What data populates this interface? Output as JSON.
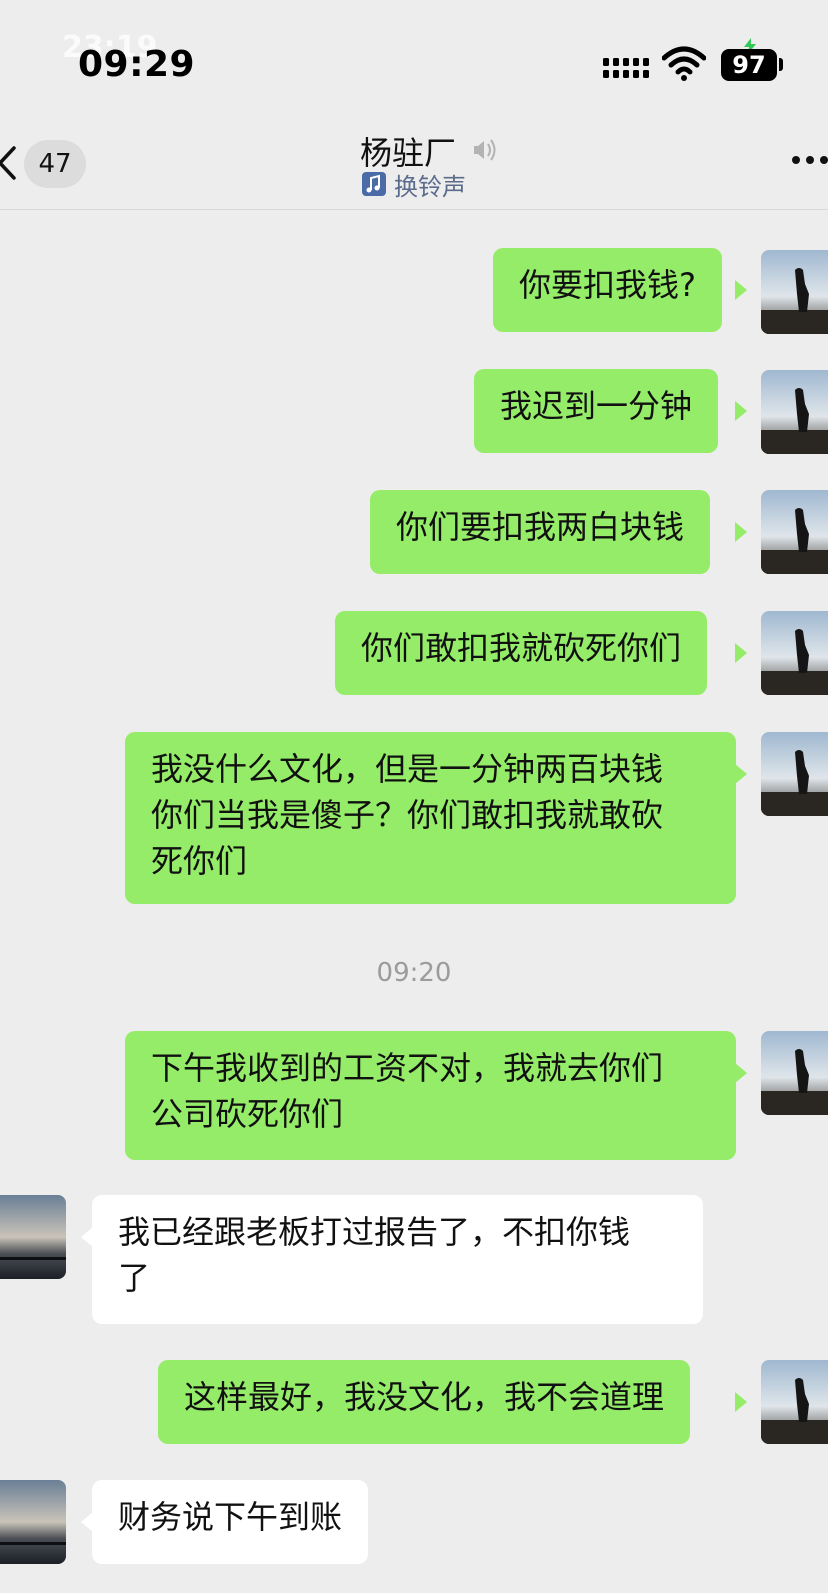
{
  "status_bar": {
    "ghost_time": "23:19",
    "time": "09:29",
    "battery": "97"
  },
  "nav": {
    "unread_count": "47",
    "title": "杨驻厂",
    "subtitle": "换铃声"
  },
  "messages": [
    {
      "side": "out",
      "text": "你要扣我钱?"
    },
    {
      "side": "out",
      "text": "我迟到一分钟"
    },
    {
      "side": "out",
      "text": "你们要扣我两白块钱"
    },
    {
      "side": "out",
      "text": "你们敢扣我就砍死你们"
    },
    {
      "side": "out",
      "line1": "我没什么文化，但是一分钟两百块钱",
      "line2": "你们当我是傻子？你们敢扣我就敢砍",
      "line3": "死你们"
    },
    {
      "side": "out",
      "line1": "下午我收到的工资不对，我就去你们",
      "line2": "公司砍死你们"
    },
    {
      "side": "in",
      "line1": "我已经跟老板打过报告了，不扣你钱",
      "line2": "了"
    },
    {
      "side": "out",
      "text": "这样最好，我没文化，我不会道理"
    },
    {
      "side": "in",
      "text": "财务说下午到账"
    }
  ],
  "timestamp": "09:20",
  "colors": {
    "background": "#ededed",
    "outgoing_bubble": "#95ec69",
    "incoming_bubble": "#ffffff",
    "ringtone_text": "#5a6b8c",
    "timestamp_text": "#9b9b9b"
  },
  "icons": [
    "back-arrow-icon",
    "sound-icon",
    "ringtone-icon",
    "more-icon",
    "signal-icon",
    "wifi-icon",
    "battery-icon"
  ]
}
